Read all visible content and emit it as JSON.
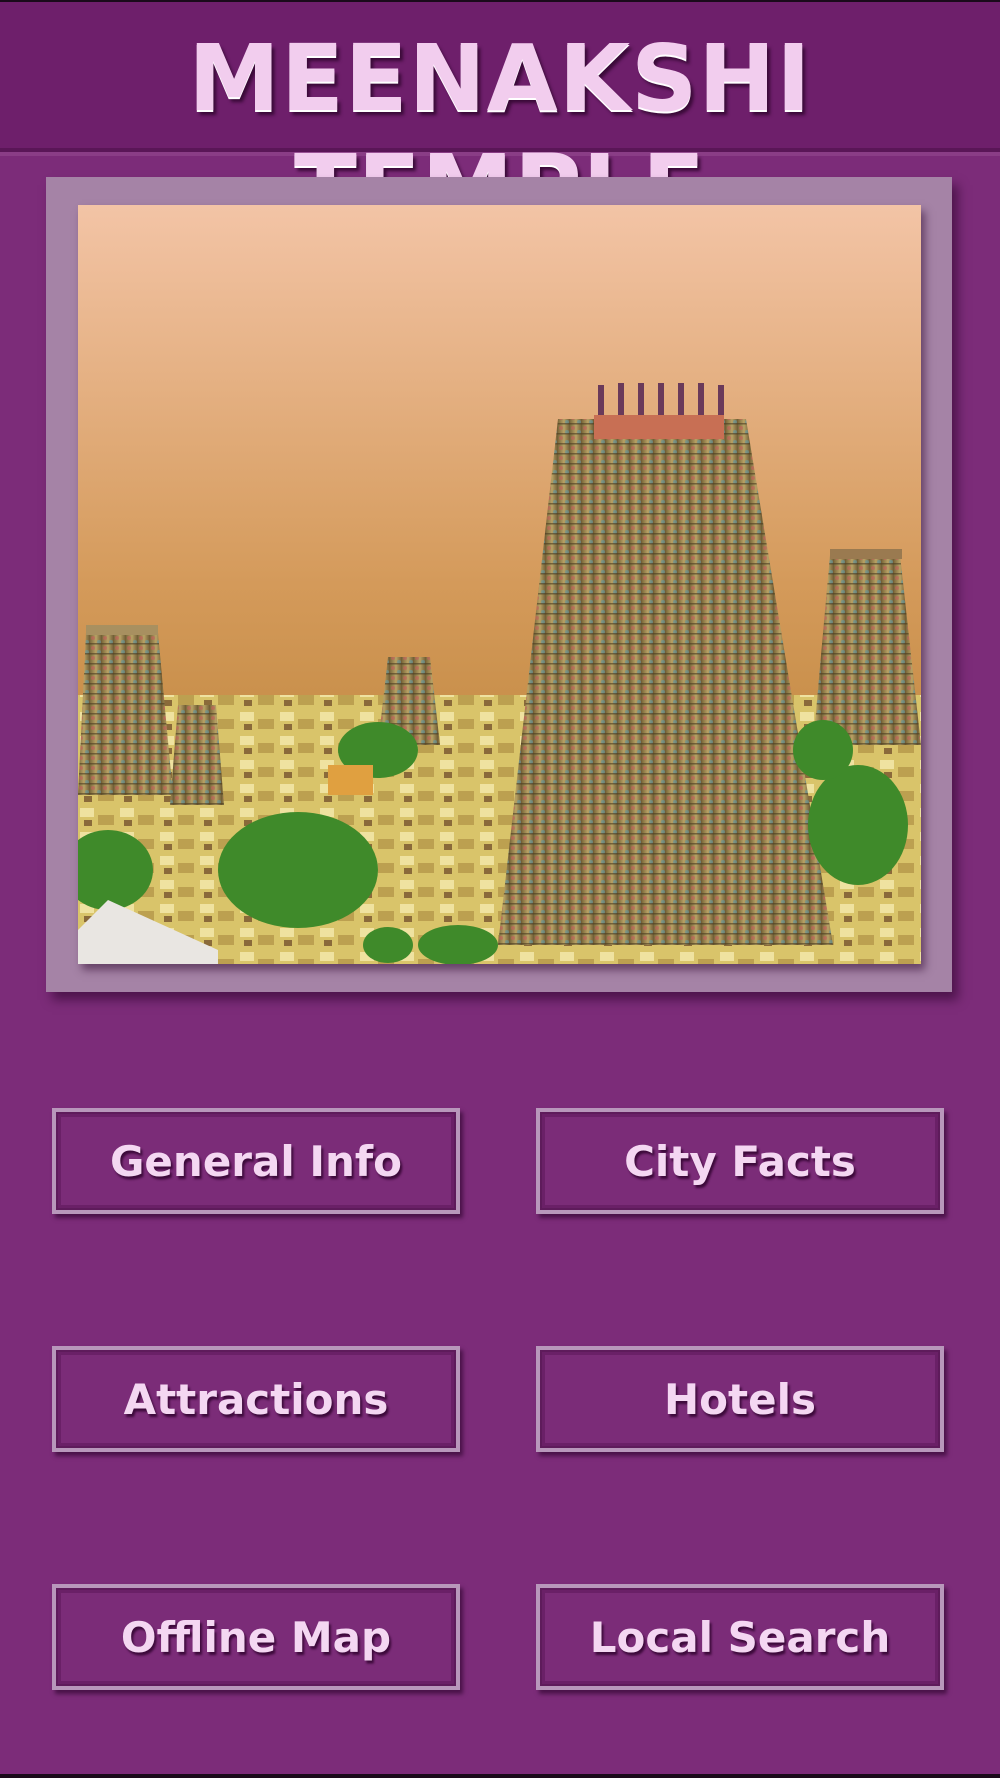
{
  "app": {
    "title": "MEENAKSHI TEMPLE"
  },
  "hero_image": {
    "description": "photo-of-temple-gopurams"
  },
  "menu": {
    "general_info": "General Info",
    "city_facts": "City Facts",
    "attractions": "Attractions",
    "hotels": "Hotels",
    "offline_map": "Offline Map",
    "local_search": "Local Search"
  },
  "colors": {
    "background": "#7c2c79",
    "header": "#6e1f6b",
    "title_text": "#f2cdee",
    "button_text": "#f4d7f2",
    "frame": "#a583a6"
  }
}
